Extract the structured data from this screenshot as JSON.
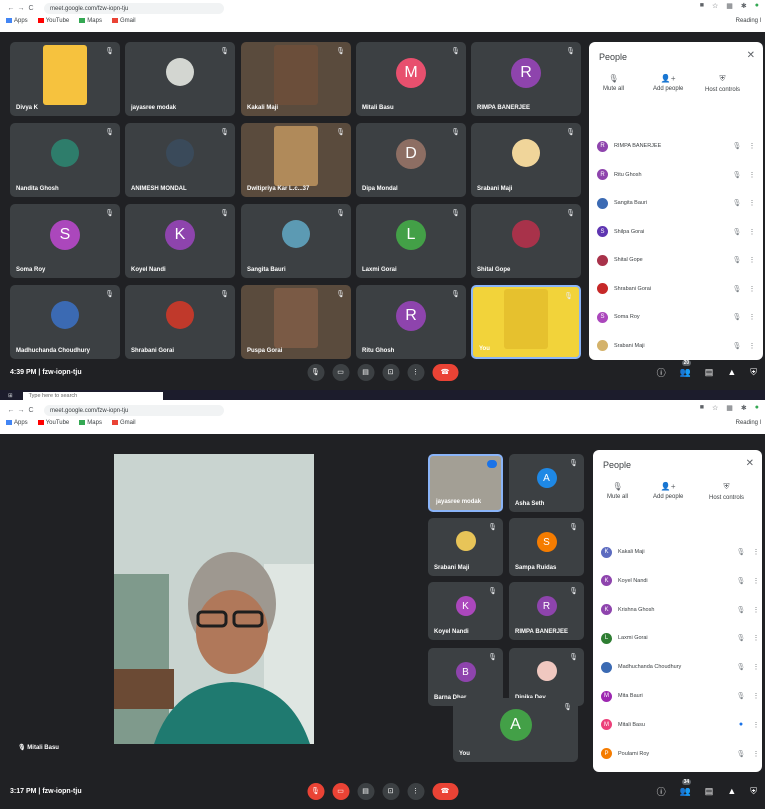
{
  "top": {
    "browser": {
      "url": "meet.google.com/fzw-iopn-tju",
      "bookmarks": [
        "Apps",
        "YouTube",
        "Maps",
        "Gmail"
      ],
      "reading_list": "Reading l"
    },
    "tiles": [
      {
        "name": "Divya K"
      },
      {
        "name": "jayasree modak"
      },
      {
        "name": "Kakali Maji"
      },
      {
        "name": "Mitali Basu",
        "initial": "M"
      },
      {
        "name": "RIMPA BANERJEE",
        "initial": "R"
      },
      {
        "name": "Nandita Ghosh"
      },
      {
        "name": "ANIMESH MONDAL"
      },
      {
        "name": "Dwitipriya Kar L.c...37"
      },
      {
        "name": "Dipa Mondal",
        "initial": "D"
      },
      {
        "name": "Srabani Maji"
      },
      {
        "name": "Soma Roy",
        "initial": "S"
      },
      {
        "name": "Koyel Nandi",
        "initial": "K"
      },
      {
        "name": "Sangita Bauri"
      },
      {
        "name": "Laxmi Gorai",
        "initial": "L"
      },
      {
        "name": "Shital Gope"
      },
      {
        "name": "Madhuchanda Choudhury"
      },
      {
        "name": "Shrabani Gorai"
      },
      {
        "name": "Puspa Gorai"
      },
      {
        "name": "Ritu Ghosh",
        "initial": "R"
      },
      {
        "name": "You"
      }
    ],
    "people_panel": {
      "title": "People",
      "actions": [
        "Mute all",
        "Add people",
        "Host controls"
      ],
      "list": [
        {
          "name": "RIMPA BANERJEE",
          "initial": "R"
        },
        {
          "name": "Ritu Ghosh",
          "initial": "R"
        },
        {
          "name": "Sangita Bauri",
          "initial": ""
        },
        {
          "name": "Shilpa Gorai",
          "initial": "S"
        },
        {
          "name": "Shital Gope",
          "initial": ""
        },
        {
          "name": "Shrabani Gorai",
          "initial": ""
        },
        {
          "name": "Soma Roy",
          "initial": "S"
        },
        {
          "name": "Srabani Maji",
          "initial": ""
        }
      ]
    },
    "bottom_bar": {
      "time": "4:39 PM",
      "meeting_code": "fzw-iopn-tju",
      "participant_count": "20"
    },
    "taskbar_search": "Type here to search"
  },
  "bottom": {
    "browser": {
      "url": "meet.google.com/fzw-iopn-tju",
      "bookmarks": [
        "Apps",
        "YouTube",
        "Maps",
        "Gmail"
      ],
      "reading_list": "Reading l"
    },
    "speaker": {
      "name": "Mitali Basu"
    },
    "tiles": [
      {
        "name": "jayasree modak"
      },
      {
        "name": "Asha Seth",
        "initial": "A"
      },
      {
        "name": "Srabani Maji"
      },
      {
        "name": "Sampa Ruidas",
        "initial": "S"
      },
      {
        "name": "Koyel Nandi",
        "initial": "K"
      },
      {
        "name": "RIMPA BANERJEE",
        "initial": "R"
      },
      {
        "name": "Barna Dhar",
        "initial": "B"
      },
      {
        "name": "Dipika Dey"
      },
      {
        "name": "You",
        "initial": "A"
      }
    ],
    "people_panel": {
      "title": "People",
      "actions": [
        "Mute all",
        "Add people",
        "Host controls"
      ],
      "list": [
        {
          "name": "Kakali Maji",
          "initial": "K"
        },
        {
          "name": "Koyel Nandi",
          "initial": "K"
        },
        {
          "name": "Krishna Ghosh",
          "initial": "K"
        },
        {
          "name": "Laxmi Gorai",
          "initial": "L"
        },
        {
          "name": "Madhuchanda Choudhury",
          "initial": ""
        },
        {
          "name": "Mita Bauri",
          "initial": "M"
        },
        {
          "name": "Mitali Basu",
          "initial": "M"
        },
        {
          "name": "Poulami Roy",
          "initial": "P"
        }
      ]
    },
    "bottom_bar": {
      "time": "3:17 PM",
      "meeting_code": "fzw-iopn-tju",
      "participant_count": "34"
    }
  }
}
